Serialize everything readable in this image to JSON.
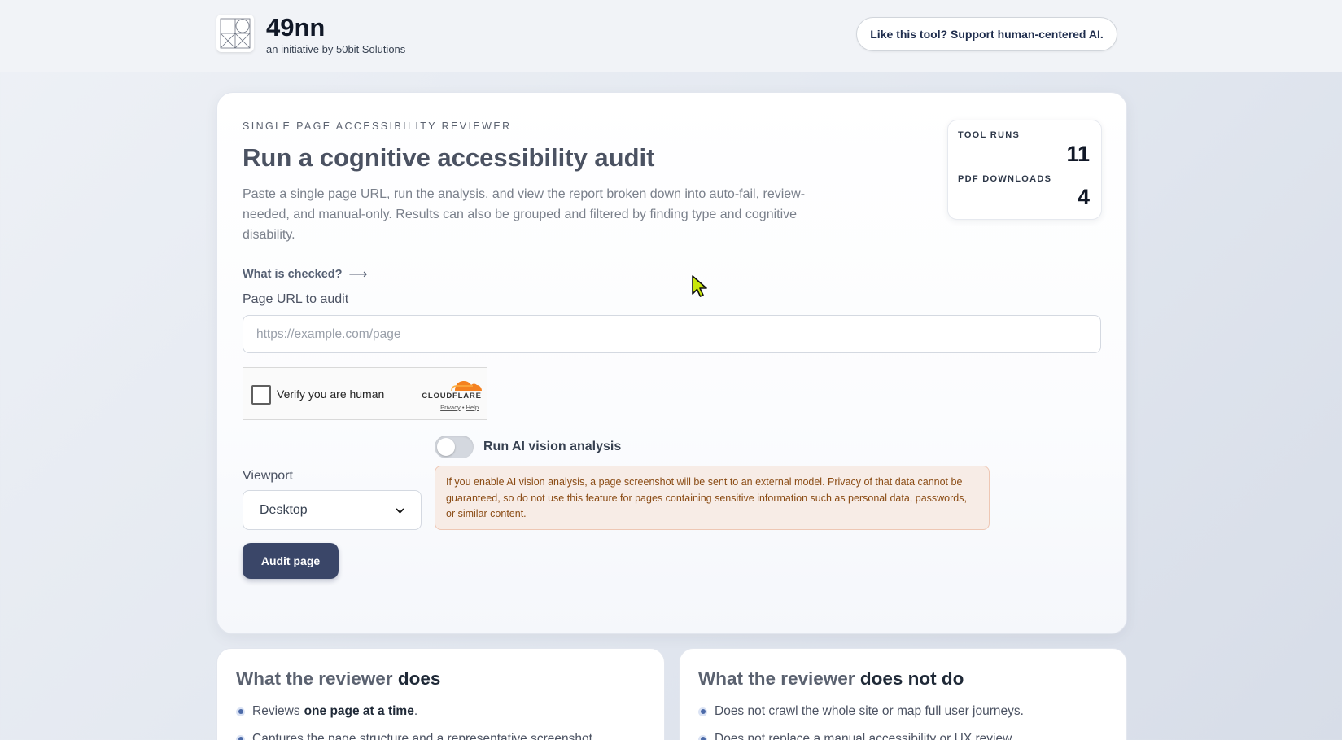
{
  "header": {
    "brand_name": "49nn",
    "brand_sub": "an initiative by 50bit Solutions",
    "support_button": "Like this tool? Support human-centered AI."
  },
  "main": {
    "eyebrow": "SINGLE PAGE ACCESSIBILITY REVIEWER",
    "title": "Run a cognitive accessibility audit",
    "description": "Paste a single page URL, run the analysis, and view the report broken down into auto-fail, review-needed, and manual-only. Results can also be grouped and filtered by finding type and cognitive disability.",
    "what_checked": "What is checked?",
    "url_label": "Page URL to audit",
    "url_placeholder": "https://example.com/page",
    "url_value": "",
    "captcha": {
      "label": "Verify you are human",
      "brand": "CLOUDFLARE",
      "privacy": "Privacy",
      "separator": "•",
      "help": "Help"
    },
    "ai_toggle_label": "Run AI vision analysis",
    "ai_toggle_on": false,
    "viewport_label": "Viewport",
    "viewport_selected": "Desktop",
    "warning": "If you enable AI vision analysis, a page screenshot will be sent to an external model. Privacy of that data cannot be guaranteed, so do not use this feature for pages containing sensitive information such as personal data, passwords, or similar content.",
    "audit_button": "Audit page"
  },
  "stats": {
    "tool_runs_label": "TOOL RUNS",
    "tool_runs_value": "11",
    "pdf_downloads_label": "PDF DOWNLOADS",
    "pdf_downloads_value": "4"
  },
  "does": {
    "title_prefix": "What the reviewer",
    "title_strong": "does",
    "item1_text": "Reviews",
    "item1_strong": "one page at a time",
    "item1_suffix": ".",
    "item2_text": "Captures the page structure and a representative screenshot"
  },
  "does_not": {
    "title_prefix": "What the reviewer",
    "title_strong": "does not do",
    "item1_text": "Does not crawl the whole site or map full user journeys.",
    "item2_text": "Does not replace a manual accessibility or UX review."
  },
  "colors": {
    "primary_button": "#3a4668",
    "warning_bg": "#f7ece6",
    "warning_text": "#8a4b14",
    "cloudflare_orange": "#f48120"
  }
}
